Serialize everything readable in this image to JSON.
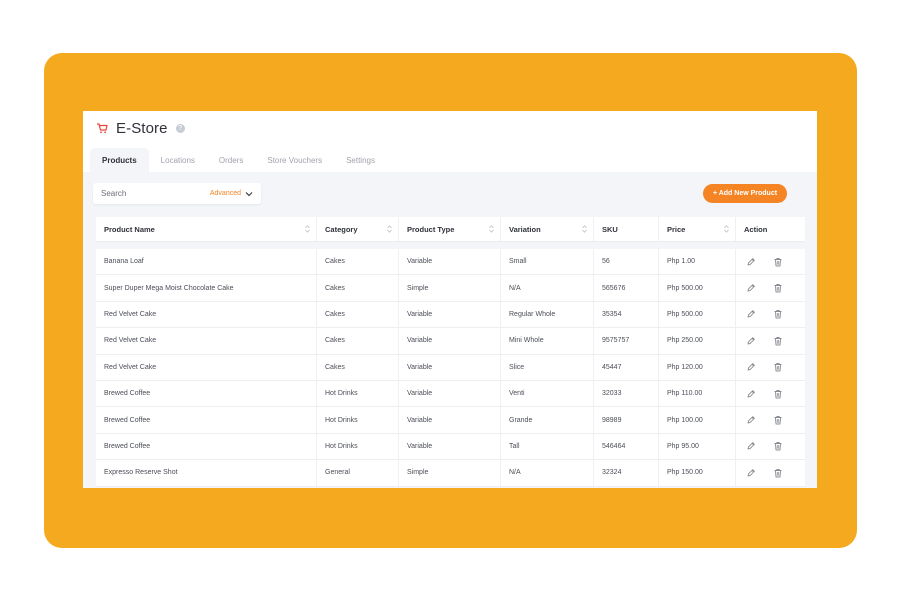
{
  "app": {
    "title": "E-Store",
    "icon": "cart-icon",
    "help_icon": "question-icon",
    "accent_color": "#f58424",
    "frame_color": "#f5a91e"
  },
  "tabs": [
    {
      "label": "Products",
      "active": true
    },
    {
      "label": "Locations",
      "active": false
    },
    {
      "label": "Orders",
      "active": false
    },
    {
      "label": "Store Vouchers",
      "active": false
    },
    {
      "label": "Settings",
      "active": false
    }
  ],
  "search": {
    "placeholder": "Search",
    "value": "",
    "advanced_label": "Advanced"
  },
  "add_button": {
    "label": "+ Add New Product"
  },
  "table": {
    "columns": [
      {
        "label": "Product Name",
        "sortable": true
      },
      {
        "label": "Category",
        "sortable": true
      },
      {
        "label": "Product Type",
        "sortable": true
      },
      {
        "label": "Variation",
        "sortable": true
      },
      {
        "label": "SKU",
        "sortable": false
      },
      {
        "label": "Price",
        "sortable": true
      },
      {
        "label": "Action",
        "sortable": false
      }
    ],
    "rows": [
      {
        "name": "Banana Loaf",
        "category": "Cakes",
        "type": "Variable",
        "variation": "Small",
        "sku": "56",
        "price": "Php 1.00"
      },
      {
        "name": "Super Duper Mega Moist Chocolate Cake",
        "category": "Cakes",
        "type": "Simple",
        "variation": "N/A",
        "sku": "565676",
        "price": "Php 500.00"
      },
      {
        "name": "Red Velvet Cake",
        "category": "Cakes",
        "type": "Variable",
        "variation": "Regular Whole",
        "sku": "35354",
        "price": "Php 500.00"
      },
      {
        "name": "Red Velvet Cake",
        "category": "Cakes",
        "type": "Variable",
        "variation": "Mini Whole",
        "sku": "9575757",
        "price": "Php 250.00"
      },
      {
        "name": "Red Velvet Cake",
        "category": "Cakes",
        "type": "Variable",
        "variation": "Slice",
        "sku": "45447",
        "price": "Php 120.00"
      },
      {
        "name": "Brewed Coffee",
        "category": "Hot Drinks",
        "type": "Variable",
        "variation": "Venti",
        "sku": "32033",
        "price": "Php 110.00"
      },
      {
        "name": "Brewed Coffee",
        "category": "Hot Drinks",
        "type": "Variable",
        "variation": "Grande",
        "sku": "98989",
        "price": "Php 100.00"
      },
      {
        "name": "Brewed Coffee",
        "category": "Hot Drinks",
        "type": "Variable",
        "variation": "Tall",
        "sku": "546464",
        "price": "Php 95.00"
      },
      {
        "name": "Expresso Reserve Shot",
        "category": "General",
        "type": "Simple",
        "variation": "N/A",
        "sku": "32324",
        "price": "Php 150.00"
      }
    ],
    "action_icons": [
      "pencil-icon",
      "trash-icon"
    ]
  }
}
